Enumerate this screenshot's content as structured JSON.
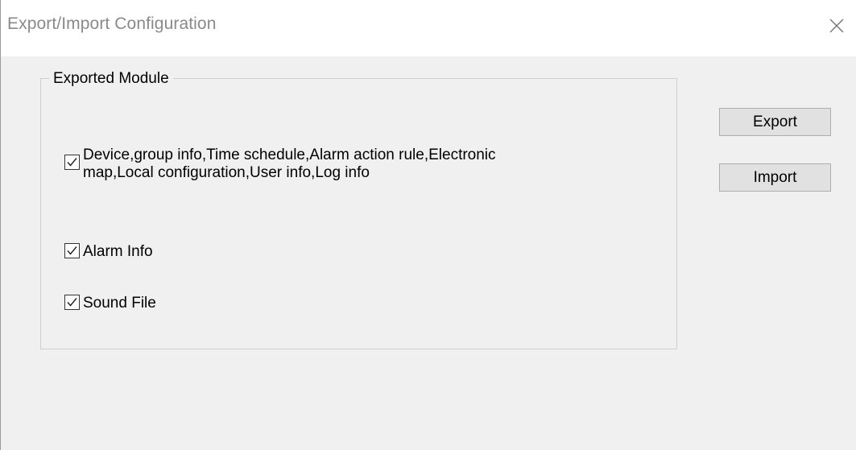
{
  "window": {
    "title": "Export/Import Configuration"
  },
  "group": {
    "legend": "Exported Module",
    "options": [
      {
        "label_line1": "Device,group info,Time schedule,Alarm action rule,Electronic",
        "label_line2": "map,Local configuration,User info,Log info",
        "checked": true
      },
      {
        "label": "Alarm Info",
        "checked": true
      },
      {
        "label": "Sound File",
        "checked": true
      }
    ]
  },
  "buttons": {
    "export_label": "Export",
    "import_label": "Import"
  }
}
